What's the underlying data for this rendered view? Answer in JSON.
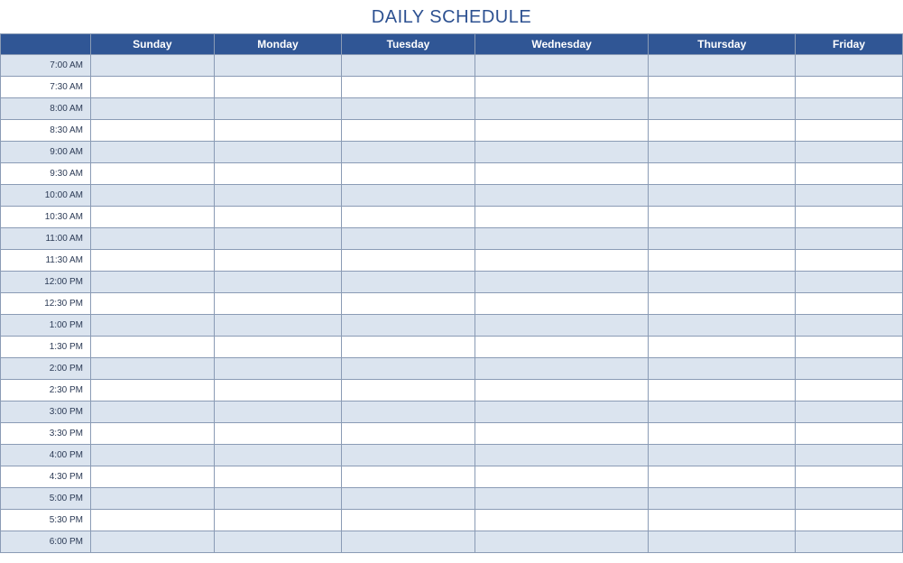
{
  "title": "DAILY SCHEDULE",
  "days": [
    "Sunday",
    "Monday",
    "Tuesday",
    "Wednesday",
    "Thursday",
    "Friday"
  ],
  "time_slots": [
    "7:00 AM",
    "7:30 AM",
    "8:00 AM",
    "8:30 AM",
    "9:00 AM",
    "9:30 AM",
    "10:00 AM",
    "10:30 AM",
    "11:00 AM",
    "11:30 AM",
    "12:00 PM",
    "12:30 PM",
    "1:00 PM",
    "1:30 PM",
    "2:00 PM",
    "2:30 PM",
    "3:00 PM",
    "3:30 PM",
    "4:00 PM",
    "4:30 PM",
    "5:00 PM",
    "5:30 PM",
    "6:00 PM"
  ],
  "colors": {
    "header_bg": "#305695",
    "row_alt_bg": "#dbe4ef",
    "title_color": "#2d5191",
    "border": "#8a9bb5"
  }
}
